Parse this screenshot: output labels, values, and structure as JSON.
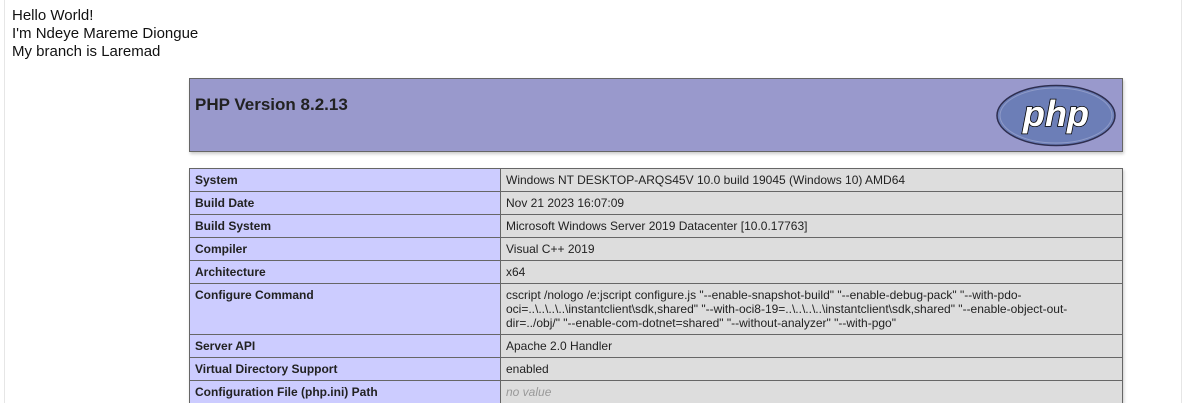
{
  "intro": {
    "line1": "Hello World!",
    "line2": "I'm Ndeye Mareme Diongue",
    "line3": "My branch is Laremad"
  },
  "header": {
    "title": "PHP Version 8.2.13",
    "logo_text": "php"
  },
  "rows": [
    {
      "key": "System",
      "value": "Windows NT DESKTOP-ARQS45V 10.0 build 19045 (Windows 10) AMD64"
    },
    {
      "key": "Build Date",
      "value": "Nov 21 2023 16:07:09"
    },
    {
      "key": "Build System",
      "value": "Microsoft Windows Server 2019 Datacenter [10.0.17763]"
    },
    {
      "key": "Compiler",
      "value": "Visual C++ 2019"
    },
    {
      "key": "Architecture",
      "value": "x64"
    },
    {
      "key": "Configure Command",
      "value": "cscript /nologo /e:jscript configure.js \"--enable-snapshot-build\" \"--enable-debug-pack\" \"--with-pdo-oci=..\\..\\..\\..\\instantclient\\sdk,shared\" \"--with-oci8-19=..\\..\\..\\..\\instantclient\\sdk,shared\" \"--enable-object-out-dir=../obj/\" \"--enable-com-dotnet=shared\" \"--without-analyzer\" \"--with-pgo\""
    },
    {
      "key": "Server API",
      "value": "Apache 2.0 Handler"
    },
    {
      "key": "Virtual Directory Support",
      "value": "enabled"
    },
    {
      "key": "Configuration File (php.ini) Path",
      "value": "no value"
    }
  ],
  "colors": {
    "header_bg": "#9999cc",
    "key_bg": "#ccccff",
    "value_bg": "#dddddd",
    "border": "#666666"
  }
}
